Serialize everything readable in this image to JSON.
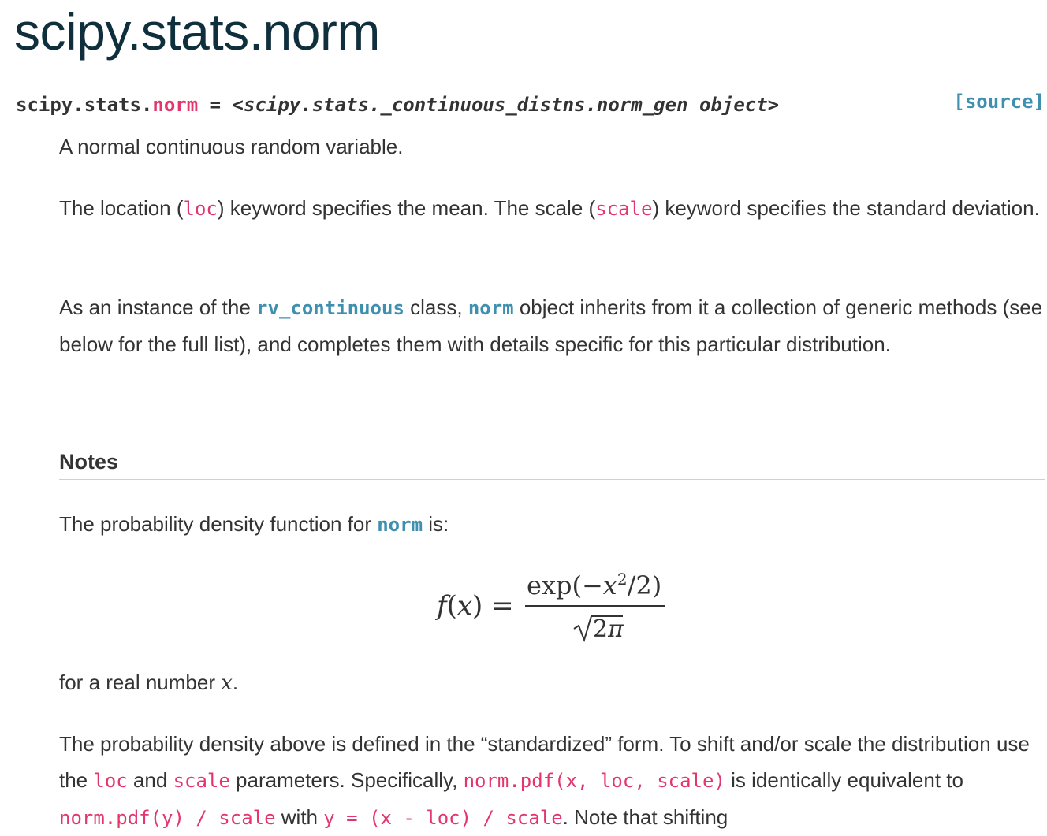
{
  "page": {
    "title": "scipy.stats.norm"
  },
  "signature": {
    "module": "scipy.stats.",
    "name": "norm",
    "equals": " = ",
    "value": "<scipy.stats._continuous_distns.norm_gen object>",
    "source_link": "[source]"
  },
  "summary": "A normal continuous random variable.",
  "para_loc": {
    "t1": "The location (",
    "c1": "loc",
    "t2": ") keyword specifies the mean. The scale (",
    "c2": "scale",
    "t3": ") keyword specifies the standard deviation."
  },
  "para_instance": {
    "t1": "As an instance of the ",
    "link1": "rv_continuous",
    "t2": " class, ",
    "link2": "norm",
    "t3": " object inherits from it a collection of generic methods (see below for the full list), and completes them with details specific for this particular distribution."
  },
  "notes": {
    "heading": "Notes",
    "pdf_intro_t1": "The probability density function for ",
    "pdf_intro_link": "norm",
    "pdf_intro_t2": " is:",
    "equation": {
      "lhs": "f(x) =",
      "numerator": "exp(−x²/2)",
      "denominator": "√2π"
    },
    "real_t1": "for a real number ",
    "real_var": "x",
    "real_t2": ".",
    "para_std": {
      "t1": "The probability density above is defined in the “standardized” form. To shift and/or scale the distribution use the ",
      "c1": "loc",
      "t2": " and ",
      "c2": "scale",
      "t3": " parameters. Specifically, ",
      "c3": "norm.pdf(x, loc, scale)",
      "t4": " is identically equivalent to ",
      "c4": "norm.pdf(y) / scale",
      "t5": " with ",
      "c5": "y = (x - loc) / scale",
      "t6": ". Note that shifting"
    }
  }
}
